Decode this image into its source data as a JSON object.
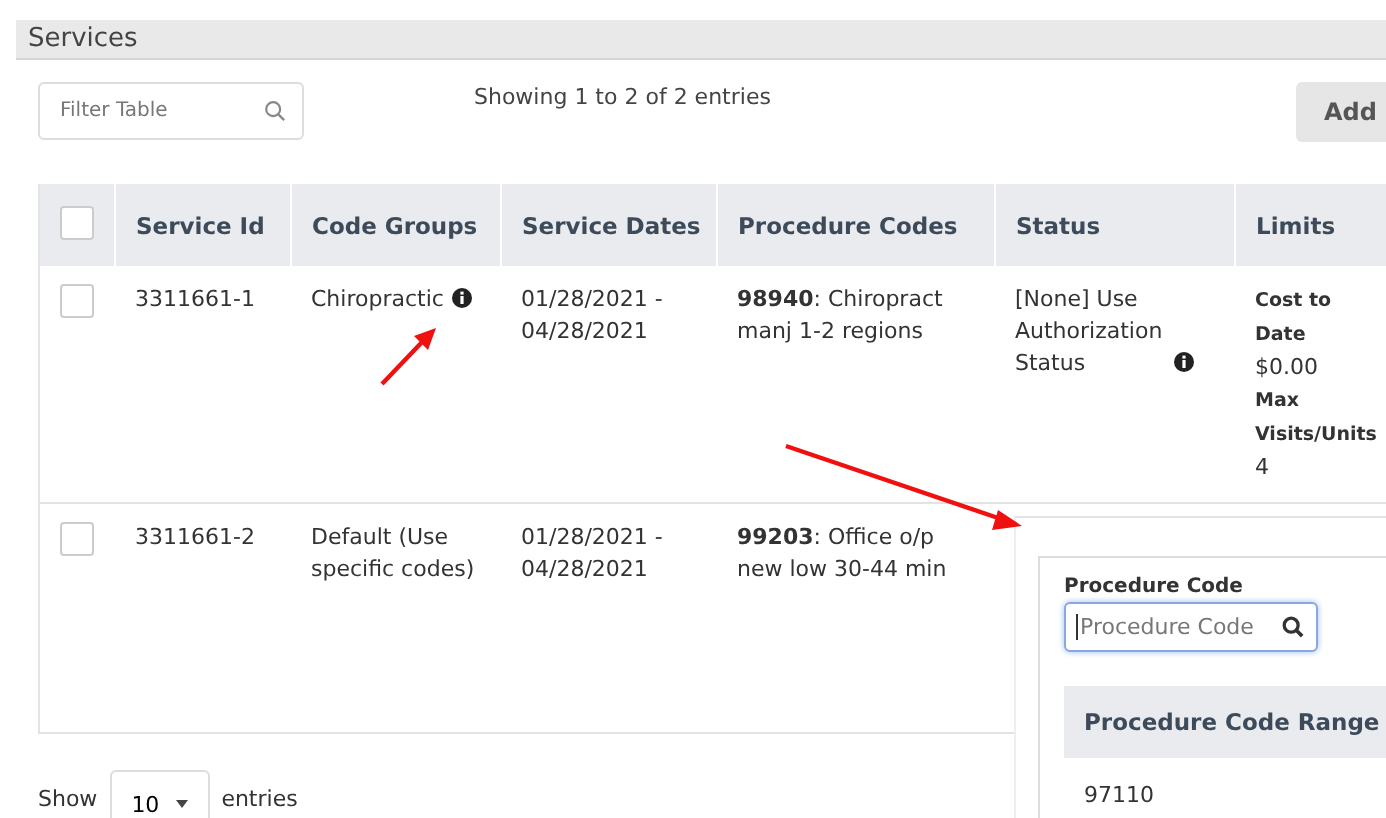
{
  "section_title": "Services",
  "filter": {
    "placeholder": "Filter Table"
  },
  "entries_info": "Showing 1 to 2 of 2 entries",
  "add_button": "Add",
  "table": {
    "select_all": {
      "checked": false
    },
    "columns": [
      "Service Id",
      "Code Groups",
      "Service Dates",
      "Procedure Codes",
      "Status",
      "Limits"
    ],
    "rows": [
      {
        "checked": false,
        "service_id": "3311661-1",
        "code_group": {
          "text": "Chiropractic",
          "info": true
        },
        "dates": "01/28/2021 - 04/28/2021",
        "procedure": "**98940**: Chiropract manj 1-2 regions",
        "status": {
          "text": "[None] Use Authorization Status",
          "info": true
        },
        "limits": [
          {
            "label": "Cost to Date",
            "value": "$0.00"
          },
          {
            "label": "Max Visits/Units",
            "value": "4"
          }
        ]
      },
      {
        "checked": false,
        "service_id": "3311661-2",
        "code_group": {
          "text": "Default (Use specific codes)",
          "info": false
        },
        "dates": "01/28/2021 - 04/28/2021",
        "procedure": "**99203**: Office o/p new low 30-44 min"
      }
    ]
  },
  "page_size": {
    "label_before": "Show",
    "value": "10",
    "label_after": "entries"
  },
  "popup": {
    "field_label": "Procedure Code",
    "placeholder": "Procedure Code",
    "table_header": "Procedure Code Range",
    "rows": [
      "97110"
    ]
  }
}
